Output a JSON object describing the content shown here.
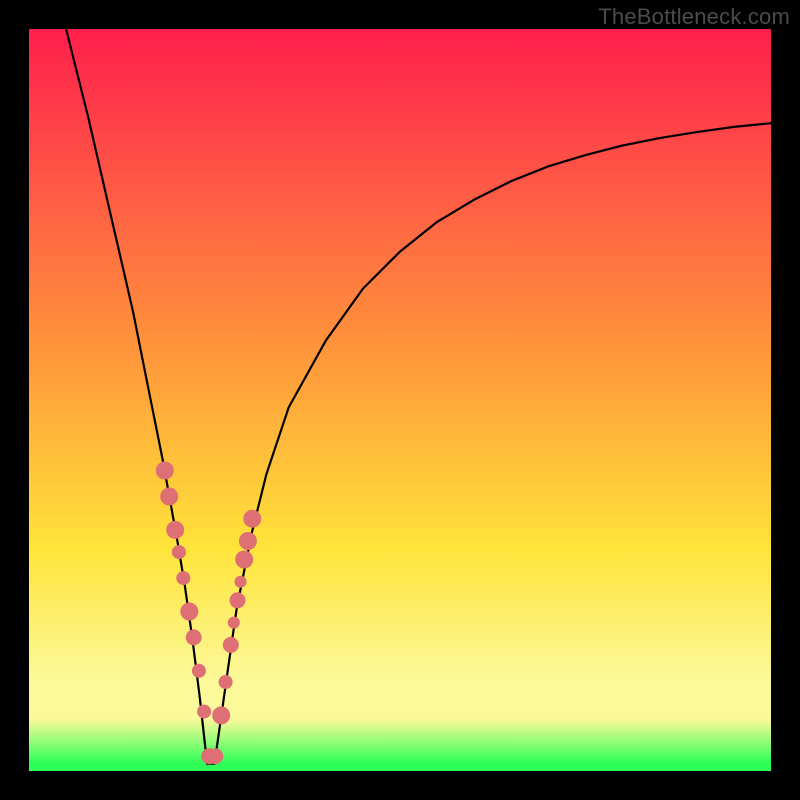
{
  "watermark": "TheBottleneck.com",
  "colors": {
    "top": "#ff1f4b",
    "red": "#ff3a4a",
    "orange": "#ff9a3a",
    "yellow": "#ffe43a",
    "paleyellow": "#fbf99a",
    "green": "#2dff57",
    "marker": "#de6f74",
    "curve": "#000000",
    "frame": "#000000"
  },
  "chart_data": {
    "type": "line",
    "title": "",
    "xlabel": "",
    "ylabel": "",
    "xlim": [
      0,
      100
    ],
    "ylim": [
      0,
      100
    ],
    "note": "V-shaped bottleneck curve; y ≈ 0 at x ≈ 24, rising steeply on both sides. Highlighted marker band near the valley.",
    "series": [
      {
        "name": "bottleneck-curve",
        "x": [
          5,
          8,
          11,
          14,
          16,
          18,
          20,
          21,
          22,
          23,
          24,
          25,
          26,
          27,
          28,
          30,
          32,
          35,
          40,
          45,
          50,
          55,
          60,
          65,
          70,
          75,
          80,
          85,
          90,
          95,
          100
        ],
        "y": [
          100,
          88,
          75,
          62,
          52,
          42,
          31,
          25,
          18,
          10,
          1,
          1,
          8,
          15,
          22,
          32,
          40,
          49,
          58,
          65,
          70,
          74,
          77,
          79.5,
          81.5,
          83,
          84.3,
          85.3,
          86.1,
          86.8,
          87.3
        ]
      }
    ],
    "markers": {
      "name": "highlighted-points",
      "x": [
        18.3,
        18.9,
        19.7,
        20.2,
        20.8,
        21.6,
        22.2,
        22.9,
        23.6,
        24.3,
        25.1,
        25.9,
        26.5,
        27.2,
        27.6,
        28.1,
        28.5,
        29.0,
        29.5,
        30.1
      ],
      "y": [
        40.5,
        37.0,
        32.5,
        29.5,
        26.0,
        21.5,
        18.0,
        13.5,
        8.0,
        2.0,
        2.0,
        7.5,
        12.0,
        17.0,
        20.0,
        23.0,
        25.5,
        28.5,
        31.0,
        34.0
      ],
      "r": [
        9,
        9,
        9,
        7,
        7,
        9,
        8,
        7,
        7,
        8,
        8,
        9,
        7,
        8,
        6,
        8,
        6,
        9,
        9,
        9
      ]
    }
  }
}
